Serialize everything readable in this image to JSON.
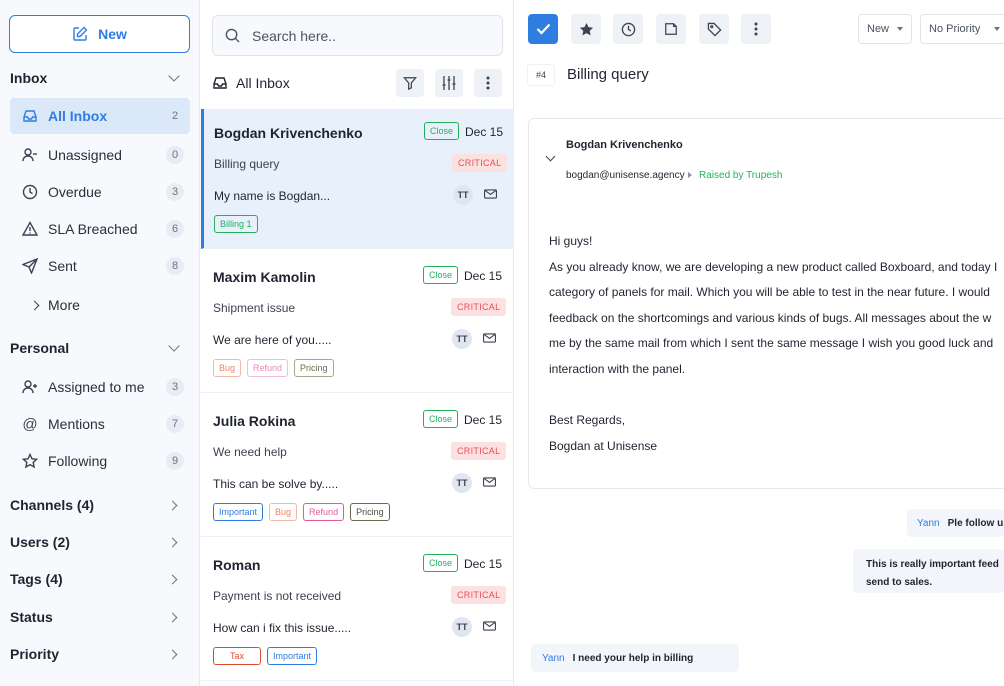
{
  "sidebar": {
    "new_label": "New",
    "inbox_heading": "Inbox",
    "inbox_items": [
      {
        "label": "All Inbox",
        "count": "2"
      },
      {
        "label": "Unassigned",
        "count": "0"
      },
      {
        "label": "Overdue",
        "count": "3"
      },
      {
        "label": "SLA Breached",
        "count": "6"
      },
      {
        "label": "Sent",
        "count": "8"
      }
    ],
    "more_label": "More",
    "personal_heading": "Personal",
    "personal_items": [
      {
        "label": "Assigned to me",
        "count": "3"
      },
      {
        "label": "Mentions",
        "count": "7"
      },
      {
        "label": "Following",
        "count": "9"
      }
    ],
    "sections": [
      "Channels (4)",
      "Users (2)",
      "Tags (4)",
      "Status",
      "Priority"
    ]
  },
  "list": {
    "search_placeholder": "Search here..",
    "title": "All Inbox",
    "close_label": "Close",
    "critical_label": "CRITICAL",
    "cards": [
      {
        "name": "Bogdan Krivenchenko",
        "date": "Dec 15",
        "subject": "Billing query",
        "preview": "My name is Bogdan...",
        "avatar": "TT",
        "tags": [
          {
            "label": "Billing 1"
          }
        ]
      },
      {
        "name": "Maxim Kamolin",
        "date": "Dec 15",
        "subject": "Shipment issue",
        "preview": "We are here of you.....",
        "avatar": "TT",
        "tags": [
          {
            "label": "Bug"
          },
          {
            "label": "Refund"
          },
          {
            "label": "Pricing"
          }
        ]
      },
      {
        "name": "Julia Rokina",
        "date": "Dec 15",
        "subject": "We need help",
        "preview": "This can be solve by.....",
        "avatar": "TT",
        "tags": [
          {
            "label": "Important"
          },
          {
            "label": "Bug"
          },
          {
            "label": "Refund"
          },
          {
            "label": "Pricing"
          }
        ]
      },
      {
        "name": "Roman",
        "date": "Dec 15",
        "subject": "Payment is not received",
        "preview": "How can i fix this issue.....",
        "avatar": "TT",
        "tags": [
          {
            "label": "Tax"
          },
          {
            "label": "Important"
          }
        ]
      }
    ]
  },
  "detail": {
    "status_value": "New",
    "priority_value": "No Priority",
    "ticket_number": "#4",
    "ticket_title": "Billing query",
    "message": {
      "from": "Bogdan Krivenchenko",
      "email": "bogdan@unisense.agency",
      "raised_by": "Raised by Trupesh",
      "greeting": "Hi guys!",
      "lines": [
        "As you already know, we are developing a new product called Boxboard, and today I",
        "category of panels for mail. Which you will be able to test in the near future. I would",
        "feedback on the shortcomings and various kinds of bugs. All messages about the w",
        "me by the same mail from which I sent the same message I wish you good luck and",
        "interaction with the panel."
      ],
      "sign_off": "Best Regards,",
      "signature": "Bogdan at Unisense"
    },
    "notes": [
      {
        "who": "Yann",
        "text": "Ple follow u"
      },
      {
        "who": "",
        "text": "This is really important feed send to sales."
      },
      {
        "who": "Yann",
        "text": "I need your help in billing"
      }
    ]
  },
  "colors": {
    "accent": "#2f7de1",
    "success": "#22b15a",
    "critical": "#e05454",
    "tag_billing": "#22b15a",
    "tag_bug": "#e8836b",
    "tag_refund": "#e05aa0",
    "tag_pricing": "#6b6b4b",
    "tag_important": "#2f7de1",
    "tag_tax": "#e04a2f"
  }
}
